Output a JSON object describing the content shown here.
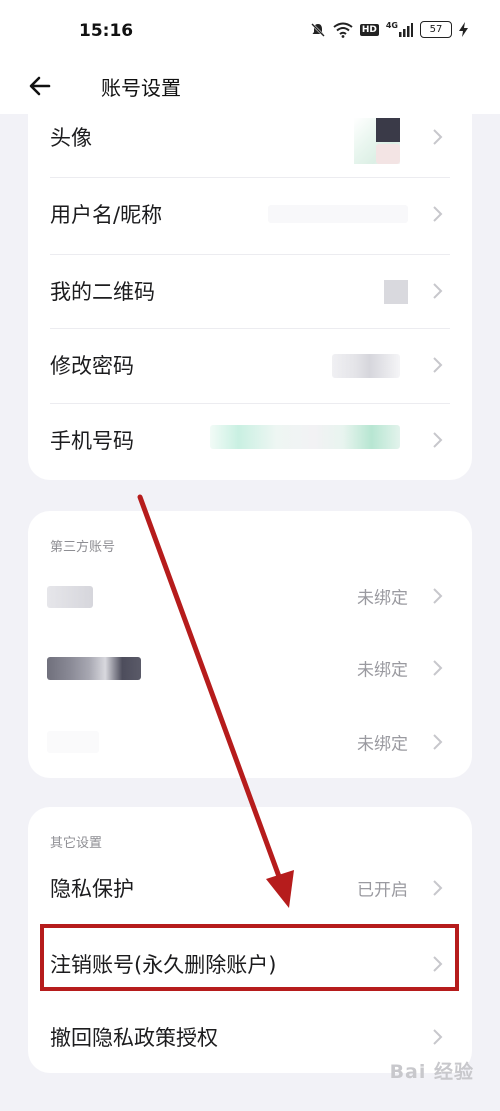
{
  "status_bar": {
    "time": "15:16",
    "network": "4G",
    "hd": "HD",
    "battery": "57"
  },
  "nav": {
    "title": "账号设置"
  },
  "account_section": {
    "items": [
      {
        "label": "头像"
      },
      {
        "label": "用户名/昵称"
      },
      {
        "label": "我的二维码"
      },
      {
        "label": "修改密码"
      },
      {
        "label": "手机号码"
      }
    ]
  },
  "third_party_section": {
    "title": "第三方账号",
    "items": [
      {
        "status": "未绑定"
      },
      {
        "status": "未绑定"
      },
      {
        "status": "未绑定"
      }
    ]
  },
  "other_section": {
    "title": "其它设置",
    "items": [
      {
        "label": "隐私保护",
        "value": "已开启"
      },
      {
        "label": "注销账号(永久删除账户)"
      },
      {
        "label": "撤回隐私政策授权"
      }
    ]
  },
  "watermark": {
    "text": "Bai 经验"
  },
  "colors": {
    "annotation": "#b61c1c",
    "background": "#f2f2f7",
    "card": "#ffffff",
    "muted": "#9a9aa0"
  }
}
